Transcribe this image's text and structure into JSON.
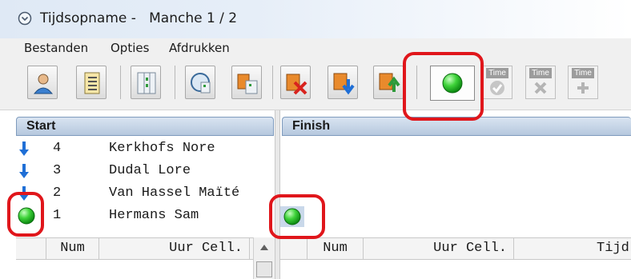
{
  "window": {
    "title": "Tijdsopname -   Manche 1 / 2"
  },
  "menu": [
    "Bestanden",
    "Opties",
    "Afdrukken"
  ],
  "toolbar": {
    "buttons": [
      "person-icon",
      "list-icon",
      "columns-icon",
      "clock-chart-icon",
      "grid-chart-icon",
      "delete-icon",
      "move-down-icon",
      "export-icon"
    ],
    "start_button": "green-circle-icon",
    "time_buttons": [
      {
        "label": "Time",
        "icon": "check-icon"
      },
      {
        "label": "Time",
        "icon": "cross-icon"
      },
      {
        "label": "Time",
        "icon": "plus-icon"
      }
    ]
  },
  "start_panel": {
    "header": "Start",
    "rows": [
      {
        "icon": "down-arrow-icon",
        "num": "4",
        "name": "Kerkhofs Nore"
      },
      {
        "icon": "down-arrow-icon",
        "num": "3",
        "name": "Dudal Lore"
      },
      {
        "icon": "down-arrow-icon",
        "num": "2",
        "name": "Van Hassel Maïté"
      },
      {
        "icon": "green-circle-icon",
        "num": "1",
        "name": "Hermans Sam"
      }
    ],
    "grid_columns": [
      "Num",
      "Uur Cell."
    ]
  },
  "finish_panel": {
    "header": "Finish",
    "grid_columns": [
      "Num",
      "Uur Cell.",
      "Tijd"
    ]
  },
  "colors": {
    "highlight": "#e0161b",
    "green": "#23c21f",
    "arrow": "#1f6fd6"
  }
}
